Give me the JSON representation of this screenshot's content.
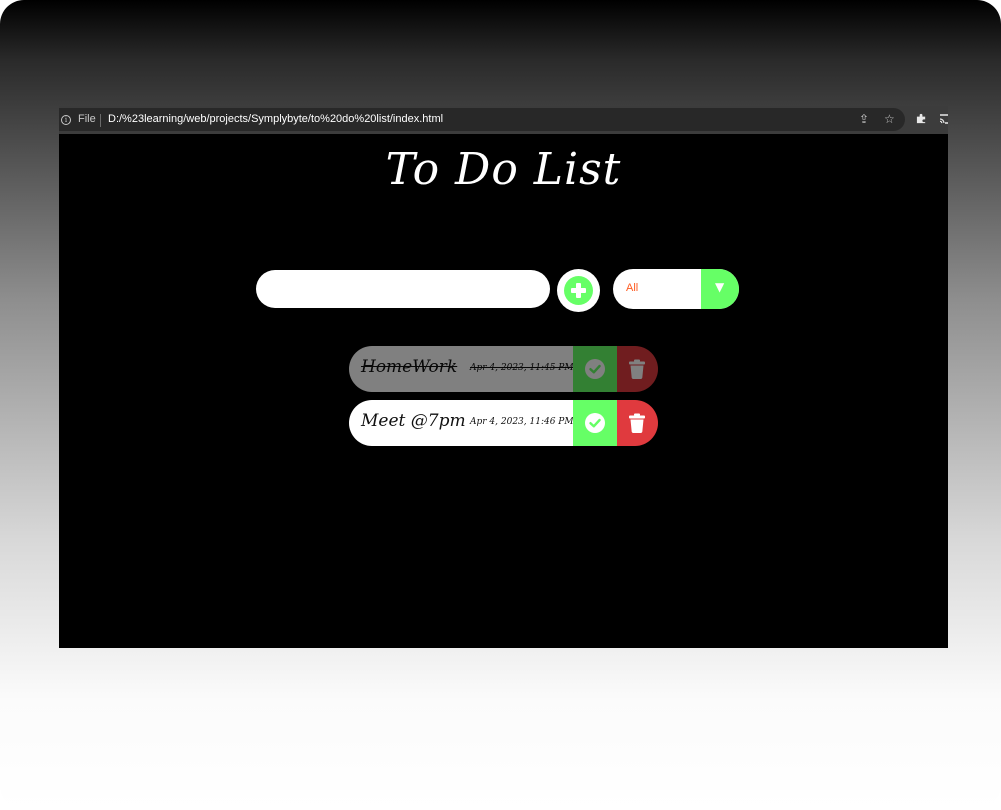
{
  "browser": {
    "file_label": "File",
    "url": "D:/%23learning/web/projects/Symplybyte/to%20do%20list/index.html"
  },
  "app": {
    "title": "To Do List",
    "input": {
      "value": "",
      "placeholder": ""
    },
    "filter": {
      "selected": "All"
    },
    "todos": [
      {
        "text": "HomeWork",
        "date": "Apr 4, 2023, 11:45 PM",
        "completed": true
      },
      {
        "text": "Meet @7pm",
        "date": "Apr 4, 2023, 11:46 PM",
        "completed": false
      }
    ]
  },
  "colors": {
    "accent_green": "#66ff66",
    "delete_red": "#e03a3e",
    "filter_text": "#ff5a1f",
    "page_background": "#000000"
  },
  "icons": {
    "add": "plus-circle-icon",
    "complete": "check-circle-icon",
    "delete": "trash-icon",
    "filter": "caret-down-icon"
  }
}
